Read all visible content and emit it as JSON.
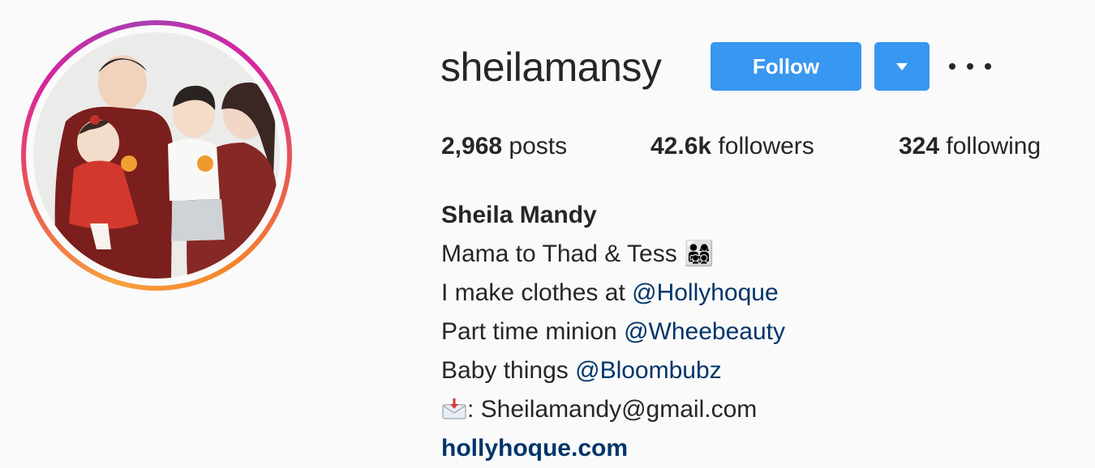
{
  "profile": {
    "username": "sheilamansy",
    "follow_label": "Follow",
    "stats": {
      "posts_count": "2,968",
      "posts_label": "posts",
      "followers_count": "42.6k",
      "followers_label": "followers",
      "following_count": "324",
      "following_label": "following"
    },
    "bio": {
      "full_name": "Sheila Mandy",
      "line1_text": "Mama to Thad & Tess ",
      "line1_emoji": "👨‍👩‍👧‍👦",
      "line2_text": "I make clothes at ",
      "line2_mention": "@Hollyhoque",
      "line3_text": "Part time minion ",
      "line3_mention": "@Wheebeauty",
      "line4_text": "Baby things ",
      "line4_mention": "@Bloombubz",
      "email_line": ": Sheilamandy@gmail.com",
      "website": "hollyhoque.com"
    }
  },
  "icons": {
    "dropdown": "chevron-down-icon",
    "more": "more-horizontal-icon",
    "email": "incoming-envelope-icon"
  },
  "colors": {
    "accent": "#3897f0",
    "link": "#003569",
    "text": "#262626",
    "background": "#fafafa"
  }
}
